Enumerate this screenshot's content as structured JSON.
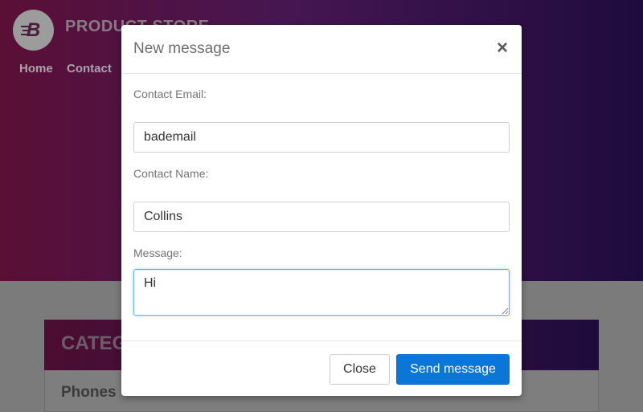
{
  "brand": {
    "logo_letter": "B",
    "name": "PRODUCT STORE"
  },
  "nav": {
    "home": "Home",
    "contact": "Contact"
  },
  "categories": {
    "title": "CATEGORIES",
    "items": [
      "Phones"
    ]
  },
  "modal": {
    "title": "New message",
    "close_symbol": "×",
    "email_label": "Contact Email:",
    "email_value": "bademail",
    "name_label": "Contact Name:",
    "name_value": "Collins",
    "message_label": "Message:",
    "message_value": "Hi",
    "close_button": "Close",
    "send_button": "Send message"
  },
  "colors": {
    "primary": "#0a76d8",
    "focus": "#66afe9"
  }
}
